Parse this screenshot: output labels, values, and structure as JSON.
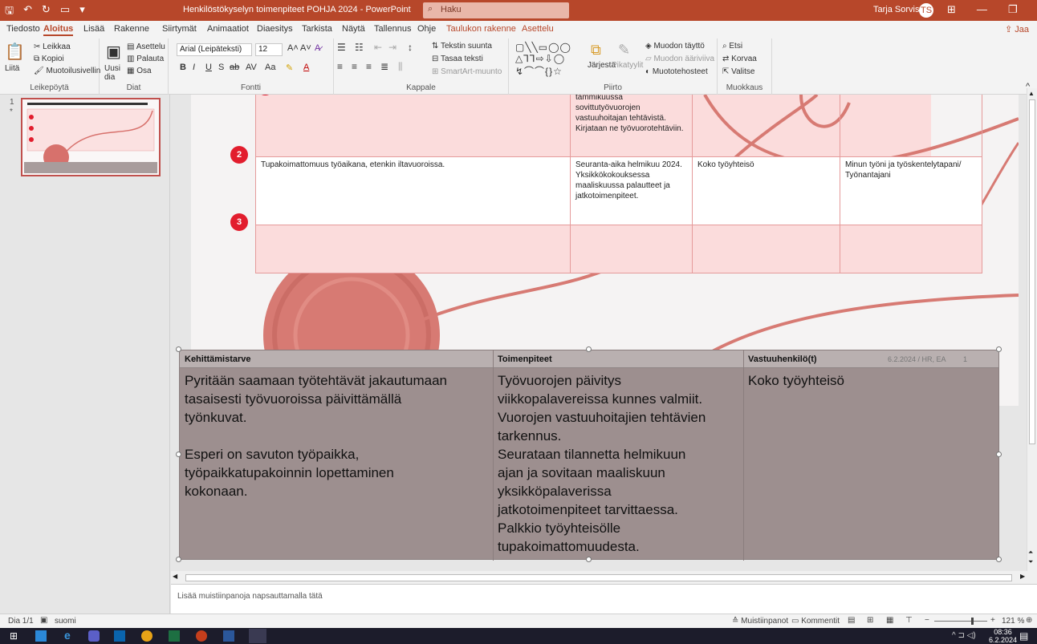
{
  "window": {
    "title": "Henkilöstökyselyn toimenpiteet POHJA 2024 - PowerPoint",
    "search_placeholder": "Haku",
    "user_name": "Tarja Sorvisto",
    "user_initials": "TS"
  },
  "tabs": [
    "Tiedosto",
    "Aloitus",
    "Lisää",
    "Rakenne",
    "Siirtymät",
    "Animaatiot",
    "Diaesitys",
    "Tarkista",
    "Näytä",
    "Tallennus",
    "Ohje",
    "Taulukon rakenne",
    "Asettelu"
  ],
  "active_tab": "Aloitus",
  "share_label": "Jaa",
  "ribbon": {
    "clipboard": {
      "paste": "Liitä",
      "cut": "Leikkaa",
      "copy": "Kopioi",
      "format_painter": "Muotoilusivellin",
      "group": "Leikepöytä"
    },
    "slides": {
      "new_slide": "Uusi dia",
      "layout": "Asettelu",
      "reset": "Palauta",
      "section": "Osa",
      "group": "Diat"
    },
    "font": {
      "font_name": "Arial (Leipäteksti)",
      "font_size": "12",
      "group": "Fontti"
    },
    "paragraph": {
      "text_direction": "Tekstin suunta",
      "align_text": "Tasaa teksti",
      "smartart": "SmartArt-muunto",
      "group": "Kappale"
    },
    "drawing": {
      "arrange": "Järjestä",
      "quick_styles": "Pikatyylit",
      "fill": "Muodon täyttö",
      "outline": "Muodon ääriviiva",
      "effects": "Muototehosteet",
      "group": "Piirto"
    },
    "editing": {
      "find": "Etsi",
      "replace": "Korvaa",
      "select": "Valitse",
      "group": "Muokkaus"
    }
  },
  "slide_number": "1",
  "slide_table": {
    "row1": {
      "col3": "tammikuussa sovittutyövuorojen vastuuhoitajan tehtävistä. Kirjataan ne työvuorotehtäviin."
    },
    "row2": {
      "num": "2",
      "col1": "Tupakoimattomuus työaikana, etenkin iltavuoroissa.",
      "col3": "Seuranta-aika helmikuu 2024. Yksikkökokouksessa maaliskuussa palautteet ja jatkotoimenpiteet.",
      "col4": "Koko työyhteisö",
      "col5": "Minun työni ja työskentelytapani/ Työnantajani"
    },
    "row3": {
      "num": "3"
    }
  },
  "overlay": {
    "headers": [
      "Kehittämistarve",
      "Toimenpiteet",
      "Vastuuhenkilö(t)"
    ],
    "footer_date": "6.2.2024 / HR, EA",
    "footer_page": "1",
    "col1": [
      "Pyritään saamaan työtehtävät jakautumaan",
      "tasaisesti työvuoroissa päivittämällä",
      "työnkuvat.",
      "",
      "Esperi on savuton työpaikka,",
      "työpaikkatupakoinnin lopettaminen",
      "kokonaan."
    ],
    "col2": [
      "Työvuorojen päivitys",
      "viikkopalavereissa kunnes valmiit.",
      "Vuorojen vastuuhoitajien tehtävien",
      "tarkennus.",
      "Seurataan tilannetta helmikuun",
      "ajan ja sovitaan maaliskuun",
      "yksikköpalaverissa",
      "jatkotoimenpiteet tarvittaessa.",
      "Palkkio työyhteisölle",
      "tupakoimattomuudesta."
    ],
    "col3": [
      "Koko työyhteisö"
    ]
  },
  "notes_placeholder": "Lisää muistiinpanoja napsauttamalla tätä",
  "status": {
    "slide": "Dia 1/1",
    "language": "suomi",
    "notes": "Muistiinpanot",
    "comments": "Kommentit",
    "zoom": "121 %"
  },
  "taskbar": {
    "time": "08:36",
    "date": "6.2.2024"
  },
  "colors": {
    "accent": "#b7472a",
    "bullet": "#e21d2d",
    "overlay": "#9d8f8f"
  }
}
